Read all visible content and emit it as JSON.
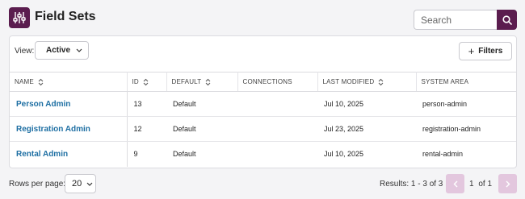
{
  "header": {
    "title": "Field Sets",
    "app_icon": "sliders-icon",
    "accent_color": "#5b1d4f"
  },
  "search": {
    "placeholder": "Search",
    "value": "",
    "button_icon": "search-icon"
  },
  "toolbar": {
    "view_label": "View:",
    "view_value": "Active",
    "filters_label": "Filters"
  },
  "table": {
    "columns": [
      "NAME",
      "ID",
      "DEFAULT",
      "CONNECTIONS",
      "LAST MODIFIED",
      "SYSTEM AREA"
    ],
    "rows": [
      {
        "name": "Person Admin",
        "id": "13",
        "default": "Default",
        "connections": "",
        "last_modified": "Jul 10, 2025",
        "system_area": "person-admin"
      },
      {
        "name": "Registration Admin",
        "id": "12",
        "default": "Default",
        "connections": "",
        "last_modified": "Jul 23, 2025",
        "system_area": "registration-admin"
      },
      {
        "name": "Rental Admin",
        "id": "9",
        "default": "Default",
        "connections": "",
        "last_modified": "Jul 10, 2025",
        "system_area": "rental-admin"
      }
    ],
    "link_color": "#1e6fa3"
  },
  "footer": {
    "rows_per_page_label": "Rows per page:",
    "rows_per_page_value": "20",
    "results_text": "Results: 1 - 3 of 3",
    "current_page": "1",
    "page_of_text": "of 1",
    "pager_color": "#e3c7de"
  }
}
